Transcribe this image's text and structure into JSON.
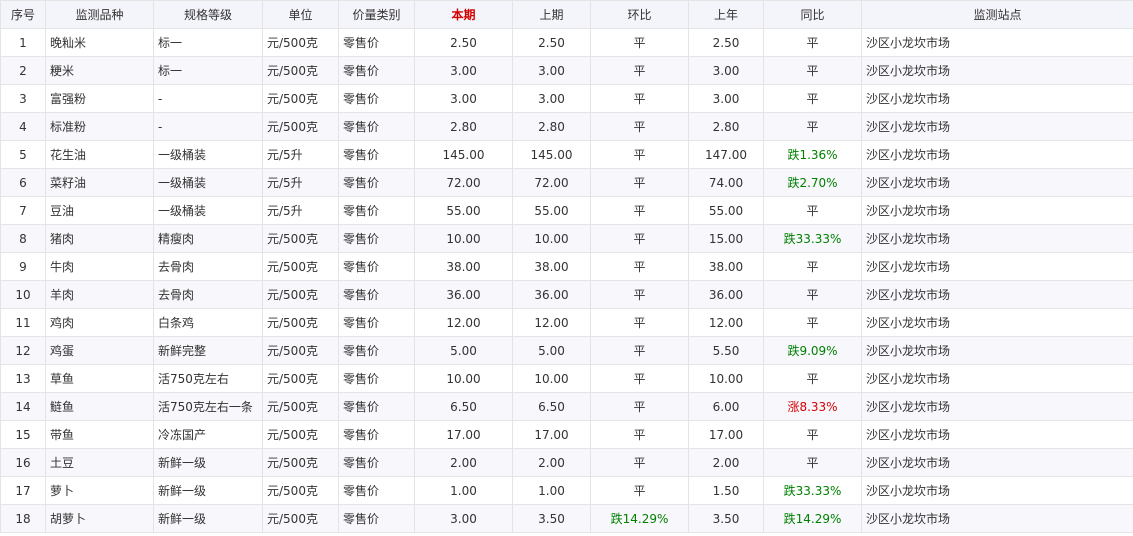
{
  "headers": [
    "序号",
    "监测品种",
    "规格等级",
    "单位",
    "价量类别",
    "本期",
    "上期",
    "环比",
    "上年",
    "同比",
    "监测站点"
  ],
  "rows": [
    {
      "idx": "1",
      "name": "晚籼米",
      "grade": "标一",
      "unit": "元/500克",
      "type": "零售价",
      "cur": "2.50",
      "prev": "2.50",
      "mom": "平",
      "last_year": "2.50",
      "yoy": "平",
      "site": "沙区小龙坎市场"
    },
    {
      "idx": "2",
      "name": "粳米",
      "grade": "标一",
      "unit": "元/500克",
      "type": "零售价",
      "cur": "3.00",
      "prev": "3.00",
      "mom": "平",
      "last_year": "3.00",
      "yoy": "平",
      "site": "沙区小龙坎市场"
    },
    {
      "idx": "3",
      "name": "富强粉",
      "grade": "-",
      "unit": "元/500克",
      "type": "零售价",
      "cur": "3.00",
      "prev": "3.00",
      "mom": "平",
      "last_year": "3.00",
      "yoy": "平",
      "site": "沙区小龙坎市场"
    },
    {
      "idx": "4",
      "name": "标准粉",
      "grade": "-",
      "unit": "元/500克",
      "type": "零售价",
      "cur": "2.80",
      "prev": "2.80",
      "mom": "平",
      "last_year": "2.80",
      "yoy": "平",
      "site": "沙区小龙坎市场"
    },
    {
      "idx": "5",
      "name": "花生油",
      "grade": "一级桶装",
      "unit": "元/5升",
      "type": "零售价",
      "cur": "145.00",
      "prev": "145.00",
      "mom": "平",
      "last_year": "147.00",
      "yoy": "跌1.36%",
      "site": "沙区小龙坎市场"
    },
    {
      "idx": "6",
      "name": "菜籽油",
      "grade": "一级桶装",
      "unit": "元/5升",
      "type": "零售价",
      "cur": "72.00",
      "prev": "72.00",
      "mom": "平",
      "last_year": "74.00",
      "yoy": "跌2.70%",
      "site": "沙区小龙坎市场"
    },
    {
      "idx": "7",
      "name": "豆油",
      "grade": "一级桶装",
      "unit": "元/5升",
      "type": "零售价",
      "cur": "55.00",
      "prev": "55.00",
      "mom": "平",
      "last_year": "55.00",
      "yoy": "平",
      "site": "沙区小龙坎市场"
    },
    {
      "idx": "8",
      "name": "猪肉",
      "grade": "精瘦肉",
      "unit": "元/500克",
      "type": "零售价",
      "cur": "10.00",
      "prev": "10.00",
      "mom": "平",
      "last_year": "15.00",
      "yoy": "跌33.33%",
      "site": "沙区小龙坎市场"
    },
    {
      "idx": "9",
      "name": "牛肉",
      "grade": "去骨肉",
      "unit": "元/500克",
      "type": "零售价",
      "cur": "38.00",
      "prev": "38.00",
      "mom": "平",
      "last_year": "38.00",
      "yoy": "平",
      "site": "沙区小龙坎市场"
    },
    {
      "idx": "10",
      "name": "羊肉",
      "grade": "去骨肉",
      "unit": "元/500克",
      "type": "零售价",
      "cur": "36.00",
      "prev": "36.00",
      "mom": "平",
      "last_year": "36.00",
      "yoy": "平",
      "site": "沙区小龙坎市场"
    },
    {
      "idx": "11",
      "name": "鸡肉",
      "grade": "白条鸡",
      "unit": "元/500克",
      "type": "零售价",
      "cur": "12.00",
      "prev": "12.00",
      "mom": "平",
      "last_year": "12.00",
      "yoy": "平",
      "site": "沙区小龙坎市场"
    },
    {
      "idx": "12",
      "name": "鸡蛋",
      "grade": "新鲜完整",
      "unit": "元/500克",
      "type": "零售价",
      "cur": "5.00",
      "prev": "5.00",
      "mom": "平",
      "last_year": "5.50",
      "yoy": "跌9.09%",
      "site": "沙区小龙坎市场"
    },
    {
      "idx": "13",
      "name": "草鱼",
      "grade": "活750克左右",
      "unit": "元/500克",
      "type": "零售价",
      "cur": "10.00",
      "prev": "10.00",
      "mom": "平",
      "last_year": "10.00",
      "yoy": "平",
      "site": "沙区小龙坎市场"
    },
    {
      "idx": "14",
      "name": "鲢鱼",
      "grade": "活750克左右一条",
      "unit": "元/500克",
      "type": "零售价",
      "cur": "6.50",
      "prev": "6.50",
      "mom": "平",
      "last_year": "6.00",
      "yoy": "涨8.33%",
      "site": "沙区小龙坎市场"
    },
    {
      "idx": "15",
      "name": "带鱼",
      "grade": "冷冻国产",
      "unit": "元/500克",
      "type": "零售价",
      "cur": "17.00",
      "prev": "17.00",
      "mom": "平",
      "last_year": "17.00",
      "yoy": "平",
      "site": "沙区小龙坎市场"
    },
    {
      "idx": "16",
      "name": "土豆",
      "grade": "新鲜一级",
      "unit": "元/500克",
      "type": "零售价",
      "cur": "2.00",
      "prev": "2.00",
      "mom": "平",
      "last_year": "2.00",
      "yoy": "平",
      "site": "沙区小龙坎市场"
    },
    {
      "idx": "17",
      "name": "萝卜",
      "grade": "新鲜一级",
      "unit": "元/500克",
      "type": "零售价",
      "cur": "1.00",
      "prev": "1.00",
      "mom": "平",
      "last_year": "1.50",
      "yoy": "跌33.33%",
      "site": "沙区小龙坎市场"
    },
    {
      "idx": "18",
      "name": "胡萝卜",
      "grade": "新鲜一级",
      "unit": "元/500克",
      "type": "零售价",
      "cur": "3.00",
      "prev": "3.50",
      "mom": "跌14.29%",
      "last_year": "3.50",
      "yoy": "跌14.29%",
      "site": "沙区小龙坎市场"
    }
  ],
  "colors": {
    "header_bg": "#f4f4fb",
    "border": "#e4e4e4",
    "current_header": "#d40000",
    "down": "#008000",
    "up": "#d40000",
    "alt_row": "#f7f7fc"
  }
}
